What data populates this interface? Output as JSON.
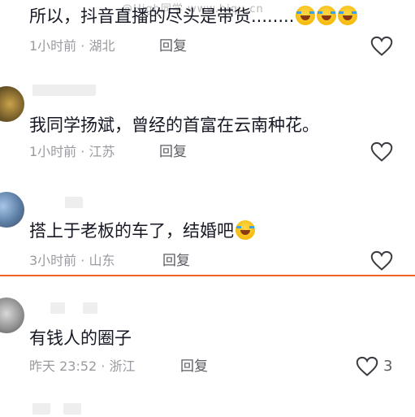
{
  "watermark": "@High同学 www.hiqu.cn",
  "comments": [
    {
      "text": "所以，抖音直播的尽头是带货........",
      "emoji_count": 3,
      "meta": "1小时前 · 湖北",
      "reply_label": "回复",
      "likes": ""
    },
    {
      "text": "我同学扬斌，曾经的首富在云南种花。",
      "emoji_count": 0,
      "meta": "1小时前 · 江苏",
      "reply_label": "回复",
      "likes": ""
    },
    {
      "text": "搭上于老板的车了，结婚吧",
      "emoji_count": 1,
      "meta": "3小时前 · 山东",
      "reply_label": "回复",
      "likes": ""
    },
    {
      "text": "有钱人的圈子",
      "emoji_count": 0,
      "meta": "昨天 23:52 · 浙江",
      "reply_label": "回复",
      "likes": "3"
    }
  ],
  "colors": {
    "accent_divider": "#f0642a",
    "meta": "#9a9ba0"
  },
  "icons": {
    "like": "heart-outline-icon",
    "emoji": "laughing-tears-emoji"
  }
}
